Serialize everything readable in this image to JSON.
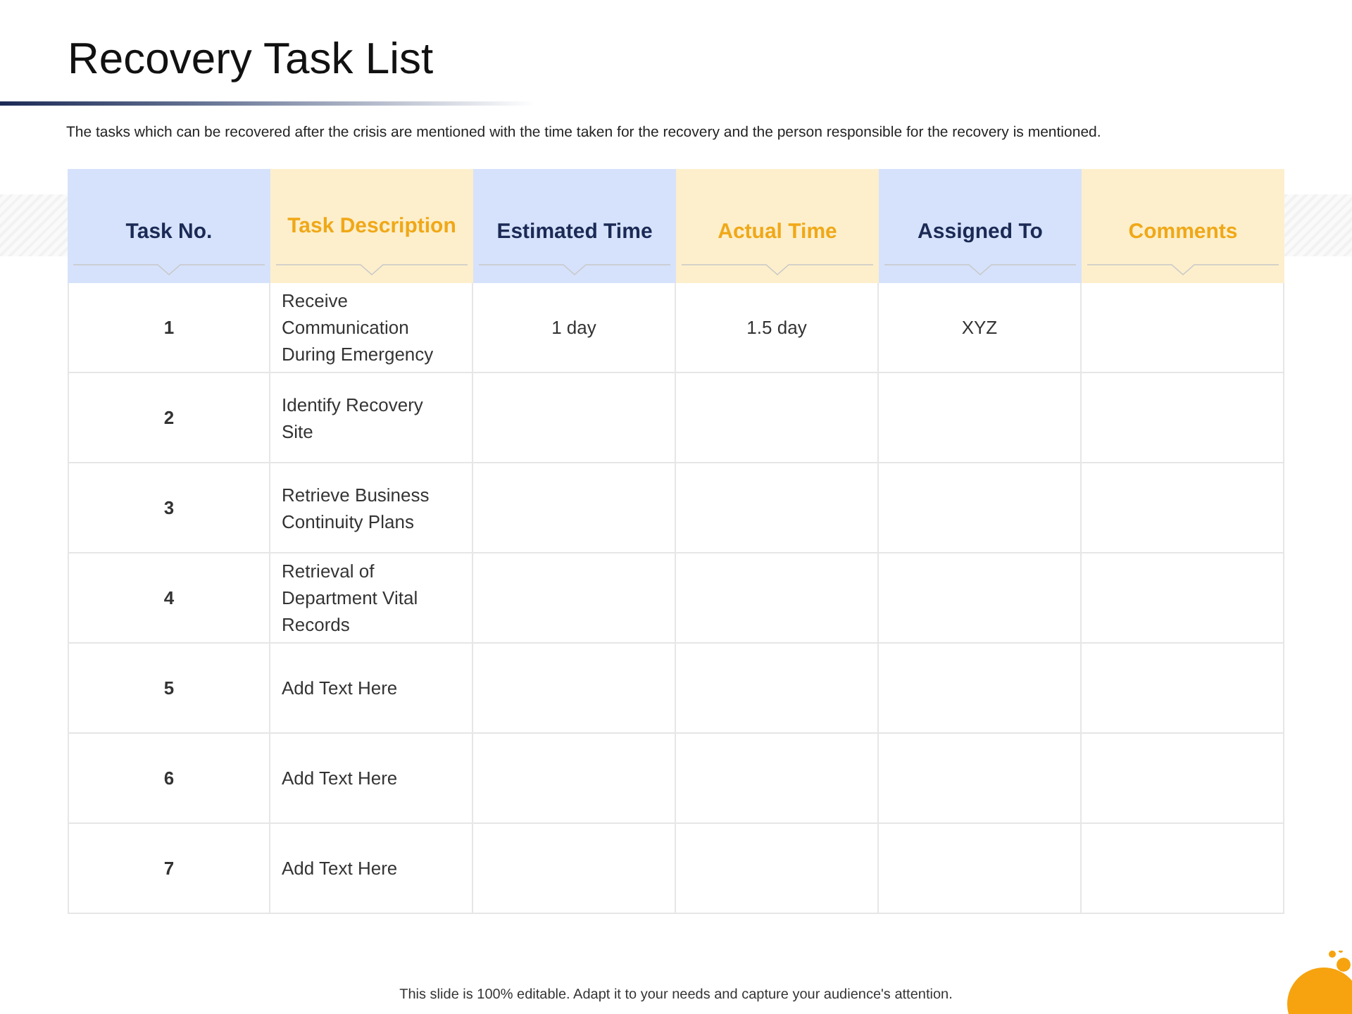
{
  "title": "Recovery Task List",
  "description": "The tasks which can be recovered after the crisis are mentioned with the time taken for the recovery and the person responsible for the recovery is mentioned.",
  "table": {
    "columns": [
      {
        "label": "Task No.",
        "kind": "primary"
      },
      {
        "label": "Task Description",
        "kind": "accent"
      },
      {
        "label": "Estimated Time",
        "kind": "primary"
      },
      {
        "label": "Actual Time",
        "kind": "accent"
      },
      {
        "label": "Assigned To",
        "kind": "primary"
      },
      {
        "label": "Comments",
        "kind": "accent"
      }
    ],
    "rows": [
      {
        "number": "1",
        "description": "Receive Communication During Emergency",
        "estimated_time": "1 day",
        "actual_time": "1.5 day",
        "assigned_to": "XYZ"
      },
      {
        "number": "2",
        "description": "Identify Recovery Site"
      },
      {
        "number": "3",
        "description": "Retrieve Business Continuity Plans"
      },
      {
        "number": "4",
        "description": "Retrieval of Department Vital Records"
      },
      {
        "number": "5",
        "description": "Add Text Here"
      },
      {
        "number": "6",
        "description": "Add Text Here"
      },
      {
        "number": "7",
        "description": "Add Text Here"
      }
    ]
  },
  "footer": "This slide is 100% editable. Adapt it to your needs and capture your audience's attention."
}
